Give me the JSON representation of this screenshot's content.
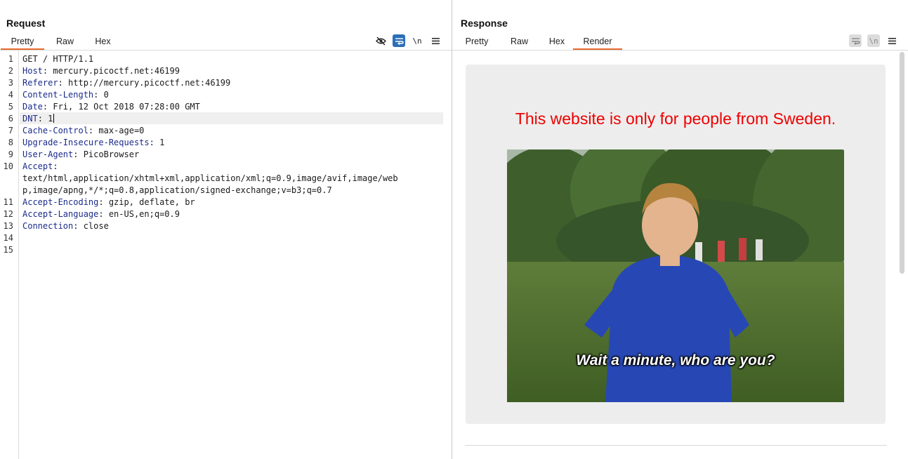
{
  "request": {
    "title": "Request",
    "tabs": [
      "Pretty",
      "Raw",
      "Hex"
    ],
    "active_tab": "Pretty",
    "toolbar": {
      "hide_icon": "eye-slash-icon",
      "wrap_icon": "word-wrap-icon",
      "newline_label": "\\n",
      "menu_icon": "hamburger-menu-icon"
    },
    "lines": [
      {
        "n": "1",
        "key": "",
        "sep": "",
        "value": "GET / HTTP/1.1"
      },
      {
        "n": "2",
        "key": "Host",
        "sep": ": ",
        "value": "mercury.picoctf.net:46199"
      },
      {
        "n": "3",
        "key": "Referer",
        "sep": ": ",
        "value": "http://mercury.picoctf.net:46199"
      },
      {
        "n": "4",
        "key": "Content-Length",
        "sep": ": ",
        "value": "0"
      },
      {
        "n": "5",
        "key": "Date",
        "sep": ": ",
        "value": "Fri, 12 Oct 2018 07:28:00 GMT"
      },
      {
        "n": "6",
        "key": "DNT",
        "sep": ": ",
        "value": "1"
      },
      {
        "n": "7",
        "key": "Cache-Control",
        "sep": ": ",
        "value": "max-age=0"
      },
      {
        "n": "8",
        "key": "Upgrade-Insecure-Requests",
        "sep": ": ",
        "value": "1"
      },
      {
        "n": "9",
        "key": "User-Agent",
        "sep": ": ",
        "value": "PicoBrowser"
      },
      {
        "n": "10",
        "key": "Accept",
        "sep": ":",
        "value": ""
      },
      {
        "n": "",
        "key": "",
        "sep": "",
        "value": "text/html,application/xhtml+xml,application/xml;q=0.9,image/avif,image/web"
      },
      {
        "n": "",
        "key": "",
        "sep": "",
        "value": "p,image/apng,*/*;q=0.8,application/signed-exchange;v=b3;q=0.7"
      },
      {
        "n": "11",
        "key": "Accept-Encoding",
        "sep": ": ",
        "value": "gzip, deflate, br"
      },
      {
        "n": "12",
        "key": "Accept-Language",
        "sep": ": ",
        "value": "en-US,en;q=0.9"
      },
      {
        "n": "13",
        "key": "Connection",
        "sep": ": ",
        "value": "close"
      },
      {
        "n": "14",
        "key": "",
        "sep": "",
        "value": ""
      },
      {
        "n": "15",
        "key": "",
        "sep": "",
        "value": ""
      }
    ],
    "cursor_line": "6"
  },
  "response": {
    "title": "Response",
    "tabs": [
      "Pretty",
      "Raw",
      "Hex",
      "Render"
    ],
    "active_tab": "Render",
    "toolbar": {
      "wrap_icon": "word-wrap-icon",
      "newline_label": "\\n",
      "menu_icon": "hamburger-menu-icon"
    },
    "render": {
      "message": "This website is only for people from Sweden.",
      "image_caption": "Wait a minute, who are you?"
    }
  },
  "view_switch": [
    "side-by-side-layout-icon",
    "stacked-layout-icon",
    "single-pane-layout-icon"
  ],
  "colors": {
    "accent_tab": "#e8692c",
    "toggle_active": "#2c6fb7",
    "header_key": "#1b2b8c",
    "render_message": "#ef0000",
    "render_card": "#ededed"
  }
}
